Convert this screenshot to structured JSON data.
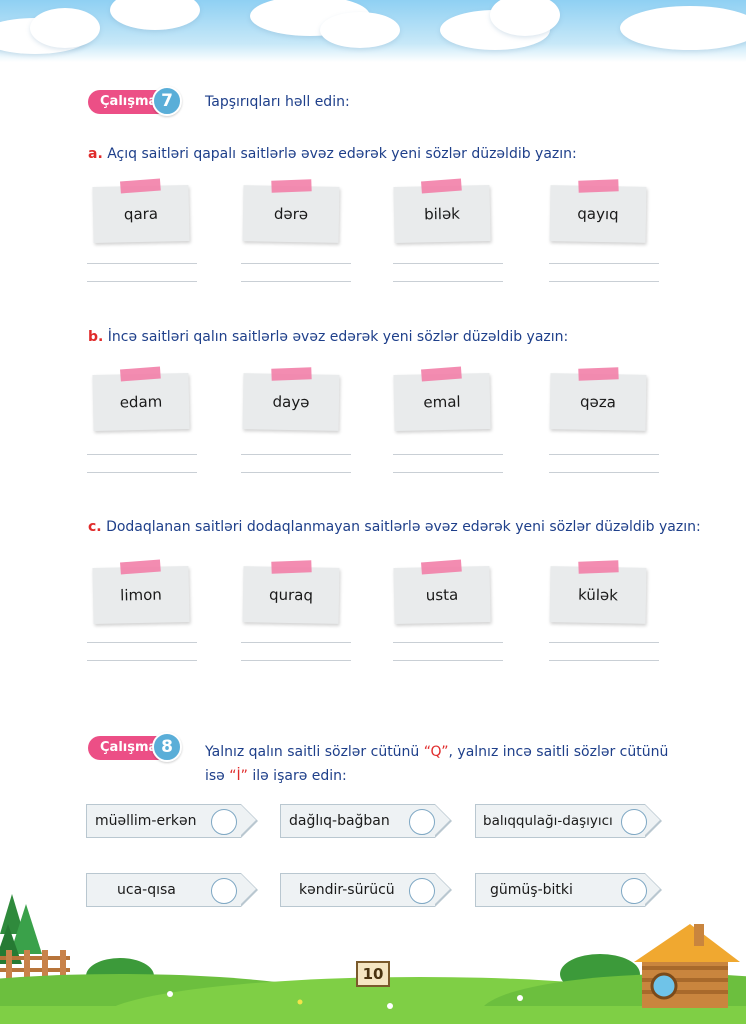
{
  "exercise7": {
    "badge": "Çalışma",
    "number": "7",
    "instruction": "Tapşırıqları həll edin:",
    "sections": [
      {
        "letter": "a.",
        "text": "Açıq saitləri qapalı saitlərlə əvəz edərək yeni sözlər düzəldib yazın:",
        "words": [
          "qara",
          "dərə",
          "bilək",
          "qayıq"
        ]
      },
      {
        "letter": "b.",
        "text": "İncə saitləri qalın saitlərlə əvəz edərək yeni sözlər düzəldib yazın:",
        "words": [
          "edam",
          "dayə",
          "emal",
          "qəza"
        ]
      },
      {
        "letter": "c.",
        "text": "Dodaqlanan saitləri dodaqlanmayan saitlərlə əvəz edərək yeni sözlər düzəldib yazın:",
        "words": [
          "limon",
          "quraq",
          "usta",
          "külək"
        ]
      }
    ]
  },
  "exercise8": {
    "badge": "Çalışma",
    "number": "8",
    "instruction_part1": "Yalnız qalın saitli sözlər cütünü ",
    "mark_q": "“Q”",
    "instruction_part2": ", yalnız incə saitli sözlər cütünü",
    "instruction_line2_part1": "isə ",
    "mark_i": "“İ”",
    "instruction_line2_part2": " ilə işarə edin:",
    "pairs": [
      "müəllim-erkən",
      "dağlıq-bağban",
      "balıqqulağı-daşıyıcı",
      "uca-qısa",
      "kəndir-sürücü",
      "gümüş-bitki"
    ]
  },
  "page_number": "10",
  "colors": {
    "badge": "#ec4f86",
    "number_circle": "#5aaed8",
    "text_blue": "#1e3f8a",
    "letter_red": "#e02b2b",
    "tape": "#f27fa9"
  }
}
